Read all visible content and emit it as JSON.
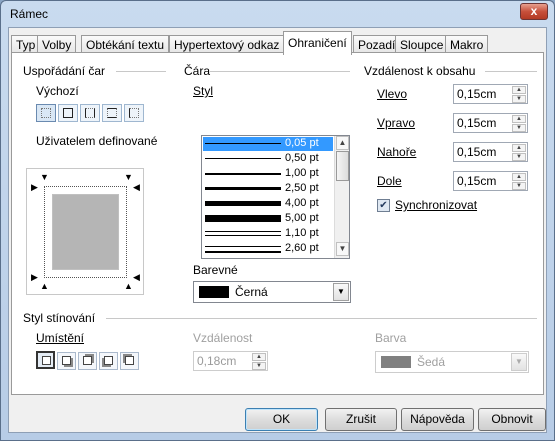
{
  "window": {
    "title": "Rámec",
    "close_glyph": "x"
  },
  "tabs": [
    {
      "label": "Typ"
    },
    {
      "label": "Volby"
    },
    {
      "label": "Obtékání textu"
    },
    {
      "label": "Hypertextový odkaz"
    },
    {
      "label": "Ohraničení",
      "active": true
    },
    {
      "label": "Pozadí"
    },
    {
      "label": "Sloupce"
    },
    {
      "label": "Makro"
    }
  ],
  "line_arrangement": {
    "title": "Uspořádání čar",
    "default_label": "Výchozí",
    "user_defined_label": "Uživatelem definované"
  },
  "line": {
    "title": "Čára",
    "style_label": "Styl",
    "styles": [
      "0,05 pt",
      "0,50 pt",
      "1,00 pt",
      "2,50 pt",
      "4,00 pt",
      "5,00 pt",
      "1,10 pt",
      "2,60 pt"
    ],
    "selected_style": "0,05 pt",
    "color_label": "Barevné",
    "color_value": "Černá",
    "color_swatch": "#000000"
  },
  "spacing": {
    "title": "Vzdálenost k obsahu",
    "left_label": "Vlevo",
    "left_value": "0,15cm",
    "right_label": "Vpravo",
    "right_value": "0,15cm",
    "top_label": "Nahoře",
    "top_value": "0,15cm",
    "bottom_label": "Dole",
    "bottom_value": "0,15cm",
    "sync_label": "Synchronizovat",
    "sync_checked": true
  },
  "shadow": {
    "title": "Styl stínování",
    "position_label": "Umístění",
    "distance_label": "Vzdálenost",
    "distance_value": "0,18cm",
    "color_label": "Barva",
    "color_value": "Šedá",
    "color_swatch": "#808080"
  },
  "buttons": {
    "ok": "OK",
    "cancel": "Zrušit",
    "help": "Nápověda",
    "reset": "Obnovit"
  }
}
